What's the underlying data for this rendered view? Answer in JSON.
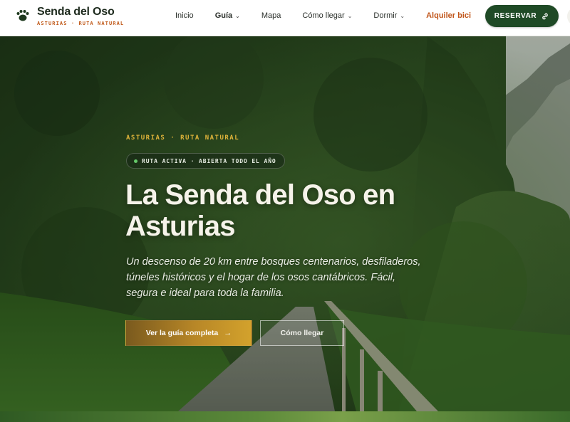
{
  "brand": {
    "name": "Senda del Oso",
    "tagline": "ASTURIAS · RUTA NATURAL",
    "icon": "paw-icon"
  },
  "nav": {
    "items": [
      {
        "label": "Inicio",
        "has_dropdown": false
      },
      {
        "label": "Guía",
        "has_dropdown": true,
        "active": true
      },
      {
        "label": "Mapa",
        "has_dropdown": false
      },
      {
        "label": "Cómo llegar",
        "has_dropdown": true
      },
      {
        "label": "Dormir",
        "has_dropdown": true
      },
      {
        "label": "Alquiler bici",
        "has_dropdown": false,
        "highlight": true
      }
    ],
    "cta_label": "RESERVAR",
    "cta_icon": "link-icon"
  },
  "hero": {
    "eyebrow": "ASTURIAS · RUTA NATURAL",
    "status": "RUTA ACTIVA · ABIERTA TODO EL AÑO",
    "title": "La Senda del Oso en Asturias",
    "description": "Un descenso de 20 km entre bosques centenarios, desfiladeros, túneles históricos y el hogar de los osos cantábricos. Fácil, segura e ideal para toda la familia.",
    "primary_button": "Ver la guía completa",
    "primary_icon": "arrow-right-icon",
    "secondary_button": "Cómo llegar"
  },
  "colors": {
    "brand_green": "#1f4a26",
    "accent_orange": "#c1561b",
    "gold": "#e0b43a",
    "status_dot": "#66c86a"
  }
}
